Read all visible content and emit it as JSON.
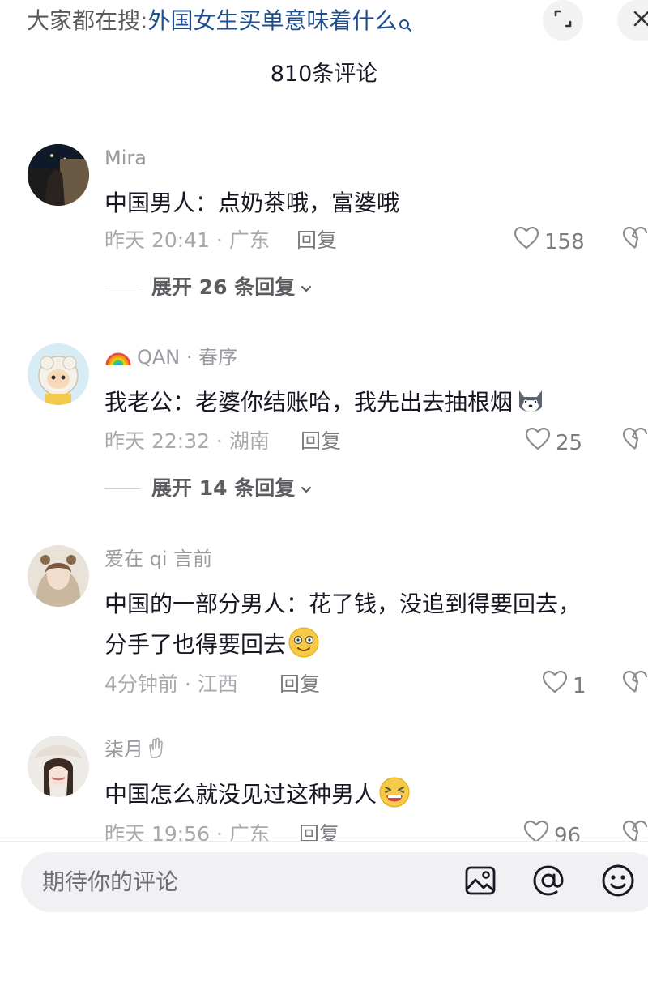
{
  "search": {
    "prefix": "大家都在搜:",
    "term": "外国女生买单意味着什么"
  },
  "header": {
    "count_label": "810条评论"
  },
  "comments": [
    {
      "username": "Mira",
      "content": "中国男人：点奶茶哦，富婆哦",
      "time_location": "昨天 20:41 · 广东",
      "reply_label": "回复",
      "likes": "158",
      "expand_label": "展开 26 条回复"
    },
    {
      "username": "QAN · 春序",
      "username_emoji": "rainbow",
      "content": "我老公：老婆你结账哈，我先出去抽根烟",
      "content_emoji": "husky-emoji",
      "time_location": "昨天 22:32 · 湖南",
      "reply_label": "回复",
      "likes": "25",
      "expand_label": "展开 14 条回复"
    },
    {
      "username": "爱在 qi 言前",
      "content_line1": "中国的一部分男人：花了钱，没追到得要回去，",
      "content_line2": "分手了也得要回去",
      "content_emoji": "dazed-smile-emoji",
      "time_location": "4分钟前 · 江西",
      "reply_label": "回复",
      "likes": "1"
    },
    {
      "username": "柒月",
      "username_emoji": "raised-hand",
      "content": "中国怎么就没见过这种男人",
      "content_emoji": "laughing-emoji",
      "time_location": "昨天 19:56 · 广东",
      "reply_label": "回复",
      "likes": "96"
    }
  ],
  "input": {
    "placeholder": "期待你的评论"
  },
  "icons": {
    "search": "search-icon",
    "expand": "expand-icon",
    "close": "close-icon",
    "like": "heart-icon",
    "dislike": "broken-heart-icon",
    "image": "image-icon",
    "mention": "at-icon",
    "emoji": "smiley-icon"
  },
  "colors": {
    "text": "#161823",
    "secondary": "#a8a9ad",
    "link": "#1f4e8c",
    "input_bg": "#f1f1f3"
  }
}
